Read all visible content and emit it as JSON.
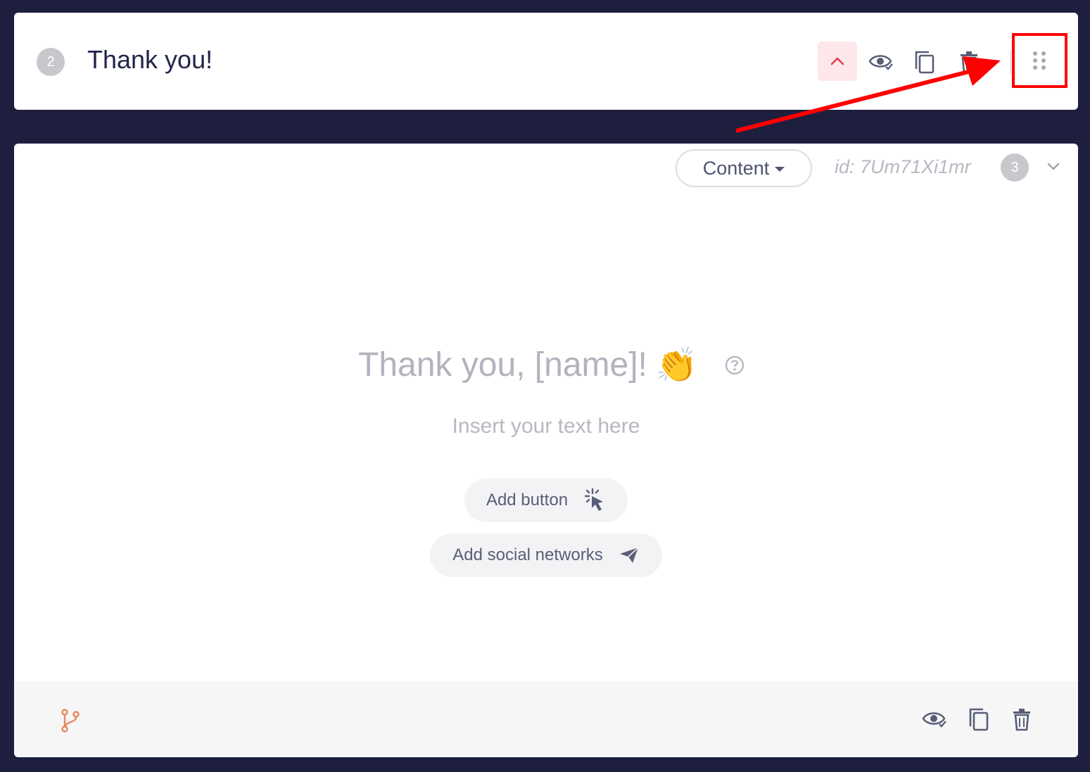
{
  "top_card": {
    "step_number": "2",
    "title": "Thank you!",
    "icons": [
      "chevron-up-icon",
      "eye-check-icon",
      "copy-icon",
      "trash-icon",
      "drag-dots-icon"
    ]
  },
  "main_card": {
    "content_dropdown": "Content",
    "block_id": "id: 7Um71Xi1mr",
    "step_number": "3",
    "heading": "Thank you, [name]!",
    "heading_emoji": "👏",
    "subtext": "Insert your text here",
    "add_button_label": "Add button",
    "add_social_label": "Add social networks"
  },
  "footer": {
    "icons": [
      "branch-icon",
      "eye-check-icon",
      "copy-icon",
      "trash-icon"
    ]
  },
  "colors": {
    "background": "#1e1f3f",
    "accent_red": "#e5384f",
    "branch_orange": "#e8875f",
    "annotation_red": "#ff0000"
  }
}
